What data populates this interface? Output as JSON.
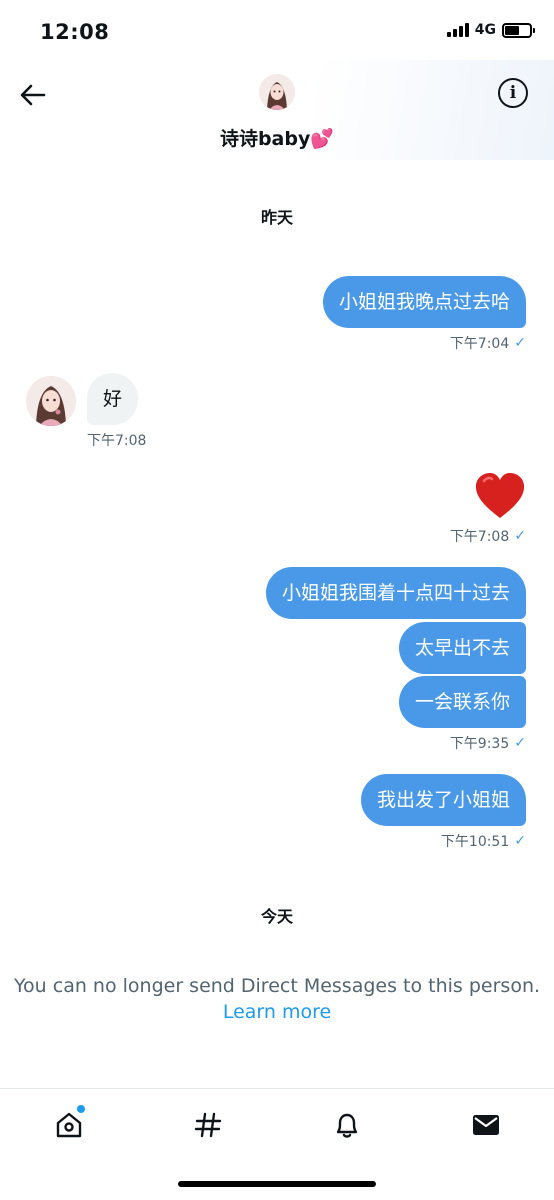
{
  "status_bar": {
    "time": "12:08",
    "network": "4G"
  },
  "header": {
    "contact_name": "诗诗baby💕"
  },
  "conversation": {
    "day_yesterday": "昨天",
    "day_today": "今天",
    "messages": [
      {
        "direction": "outgoing",
        "text": "小姐姐我晚点过去哈",
        "time": "下午7:04",
        "read": "✓"
      },
      {
        "direction": "incoming",
        "text": "好",
        "time": "下午7:08"
      },
      {
        "direction": "outgoing",
        "emoji": "red-heart",
        "time": "下午7:08",
        "read": "✓"
      },
      {
        "direction": "outgoing",
        "text": "小姐姐我围着十点四十过去"
      },
      {
        "direction": "outgoing",
        "text": "太早出不去"
      },
      {
        "direction": "outgoing",
        "text": "一会联系你",
        "time": "下午9:35",
        "read": "✓"
      },
      {
        "direction": "outgoing",
        "text": "我出发了小姐姐",
        "time": "下午10:51",
        "read": "✓"
      }
    ]
  },
  "notice": {
    "text": "You can no longer send Direct Messages to this person.",
    "link": "Learn more"
  },
  "tabbar": {
    "items": [
      "home-icon",
      "explore-hashtag-icon",
      "notifications-bell-icon",
      "messages-envelope-icon"
    ],
    "home_has_notification_dot": true
  },
  "colors": {
    "outgoing_bubble": "#4a99e9",
    "incoming_bubble": "#eff3f4",
    "link": "#1d9bf0",
    "muted_text": "#536471"
  }
}
